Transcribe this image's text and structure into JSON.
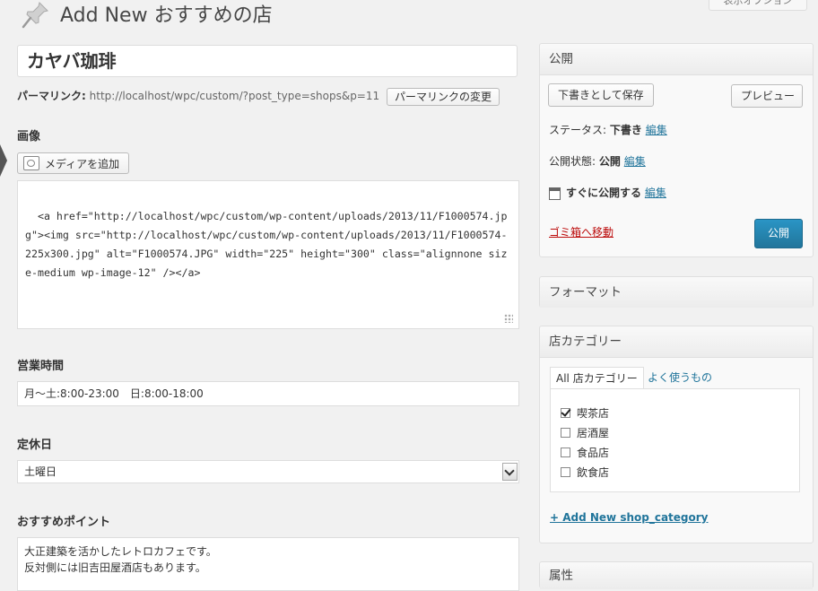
{
  "header": {
    "title": "Add New おすすめの店",
    "screen_options": "表示オプション"
  },
  "post": {
    "title": "カヤバ珈琲",
    "permalink_label": "パーマリンク:",
    "permalink_url": "http://localhost/wpc/custom/?post_type=shops&p=11",
    "permalink_button": "パーマリンクの変更"
  },
  "fields": {
    "image": {
      "label": "画像",
      "media_button": "メディアを追加",
      "content": "<a href=\"http://localhost/wpc/custom/wp-content/uploads/2013/11/F1000574.jpg\"><img src=\"http://localhost/wpc/custom/wp-content/uploads/2013/11/F1000574-225x300.jpg\" alt=\"F1000574.JPG\" width=\"225\" height=\"300\" class=\"alignnone size-medium wp-image-12\" /></a>"
    },
    "hours": {
      "label": "営業時間",
      "value": "月〜土:8:00-23:00　日:8:00-18:00"
    },
    "holiday": {
      "label": "定休日",
      "value": "土曜日"
    },
    "recommend": {
      "label": "おすすめポイント",
      "lines": [
        "大正建築を活かしたレトロカフェです。",
        "反対側には旧吉田屋酒店もあります。"
      ]
    }
  },
  "publish_box": {
    "title": "公開",
    "save_draft": "下書きとして保存",
    "preview": "プレビュー",
    "status_label": "ステータス:",
    "status_value": "下書き",
    "visibility_label": "公開状態:",
    "visibility_value": "公開",
    "schedule_text": "すぐに公開する",
    "edit": "編集",
    "trash": "ゴミ箱へ移動",
    "publish": "公開"
  },
  "format_box": {
    "title": "フォーマット"
  },
  "category_box": {
    "title": "店カテゴリー",
    "tab_all": "All 店カテゴリー",
    "tab_popular": "よく使うもの",
    "items": [
      {
        "label": "喫茶店",
        "checked": true
      },
      {
        "label": "居酒屋",
        "checked": false
      },
      {
        "label": "食品店",
        "checked": false
      },
      {
        "label": "飲食店",
        "checked": false
      }
    ],
    "add_new": "+ Add New shop_category"
  },
  "tags_box": {
    "title": "属性"
  },
  "colors": {
    "link": "#21759b",
    "trash": "#bc0b0b",
    "publish_button": "#21759b"
  }
}
